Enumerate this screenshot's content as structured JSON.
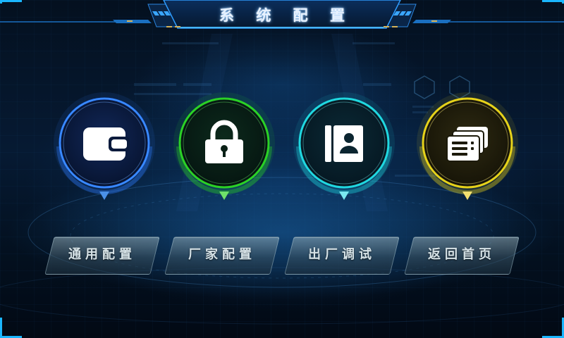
{
  "title": "系 统 配 置",
  "menu": [
    {
      "id": "general",
      "label": "通用配置",
      "icon": "wallet-icon",
      "color": "#2f7bff",
      "glow": "#4aa0ff"
    },
    {
      "id": "factory",
      "label": "厂家配置",
      "icon": "lock-icon",
      "color": "#2bd126",
      "glow": "#49f03a"
    },
    {
      "id": "debug",
      "label": "出厂调试",
      "icon": "contact-book-icon",
      "color": "#20d8e0",
      "glow": "#3df0f5"
    },
    {
      "id": "home",
      "label": "返回首页",
      "icon": "cards-icon",
      "color": "#e6d21a",
      "glow": "#ffe93a"
    }
  ]
}
